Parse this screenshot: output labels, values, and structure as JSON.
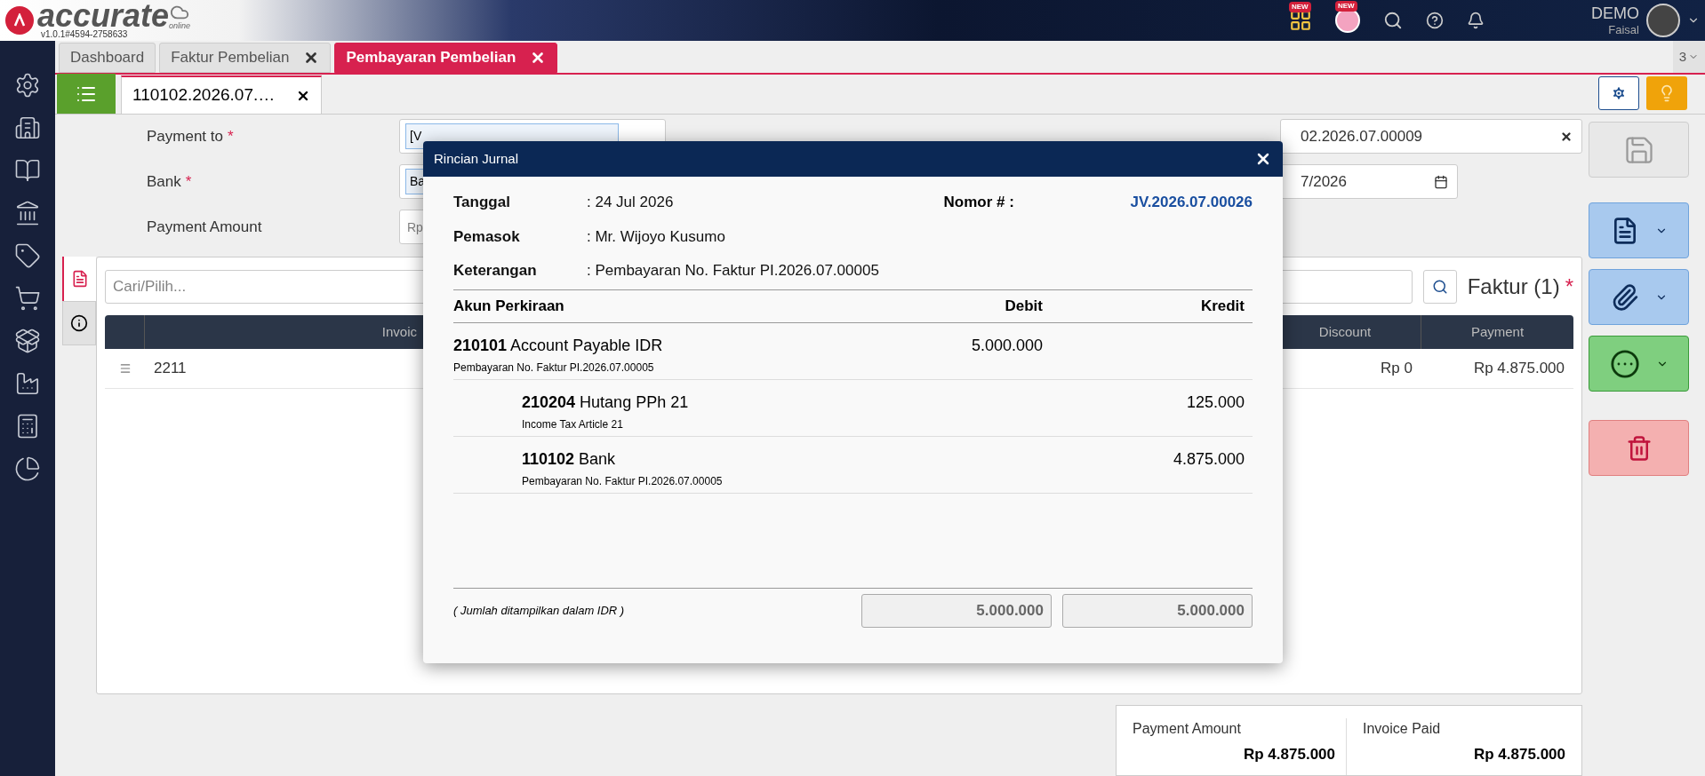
{
  "header": {
    "logo": "accurate",
    "logo_sub": "online",
    "version": "v1.0.1#4594-2758633",
    "badges": [
      "NEW",
      "NEW"
    ],
    "company": "DEMO",
    "user": "Faisal"
  },
  "tabs": [
    {
      "label": "Dashboard",
      "closable": false,
      "selected": false
    },
    {
      "label": "Faktur Pembelian",
      "closable": true,
      "selected": false
    },
    {
      "label": "Pembayaran Pembelian",
      "closable": true,
      "selected": true
    }
  ],
  "tab_count": "3",
  "doc_tabs": [
    {
      "label": "110102.2026.07.…",
      "selected": true
    }
  ],
  "form": {
    "fields": [
      {
        "label": "Payment to",
        "required_mark": "*",
        "value": "[V"
      },
      {
        "label": "Bank",
        "required_mark": "*",
        "value": "Ba"
      },
      {
        "label": "Payment Amount",
        "placeholder": "Rp"
      }
    ],
    "number_value": "02.2026.07.00009",
    "date_value": "7/2026"
  },
  "panel": {
    "search_placeholder": "Cari/Pilih...",
    "title": "Faktur (1)",
    "required_mark": "*",
    "columns": [
      "Invoic",
      "Discount",
      "Payment"
    ],
    "rows": [
      {
        "cells": [
          "2211",
          "Rp 0",
          "Rp 4.875.000"
        ]
      }
    ]
  },
  "summary": [
    {
      "label": "Payment Amount",
      "value": "Rp 4.875.000"
    },
    {
      "label": "Invoice Paid",
      "value": "Rp 4.875.000"
    }
  ],
  "modal": {
    "title": "Rincian Jurnal",
    "fields": [
      {
        "label": "Tanggal",
        "value": ": 24 Jul 2026"
      },
      {
        "label": "Pemasok",
        "value": ": Mr. Wijoyo Kusumo"
      },
      {
        "label": "Keterangan",
        "value": ": Pembayaran No. Faktur PI.2026.07.00005"
      }
    ],
    "number_label": "Nomor # :",
    "number_value": "JV.2026.07.00026",
    "columns": [
      "Akun Perkiraan",
      "Debit",
      "Kredit"
    ],
    "entries": [
      {
        "kind": "debit",
        "code": "210101",
        "name": "Account Payable IDR",
        "memo": "Pembayaran No. Faktur PI.2026.07.00005",
        "amount": "5.000.000"
      },
      {
        "kind": "credit",
        "code": "210204",
        "name": "Hutang PPh 21",
        "memo": "Income Tax Article 21",
        "amount": "125.000"
      },
      {
        "kind": "credit",
        "code": "110102",
        "name": "Bank",
        "memo": "Pembayaran No. Faktur PI.2026.07.00005",
        "amount": "4.875.000"
      }
    ],
    "note": "( Jumlah ditampilkan dalam IDR )",
    "totals": [
      "5.000.000",
      "5.000.000"
    ]
  }
}
